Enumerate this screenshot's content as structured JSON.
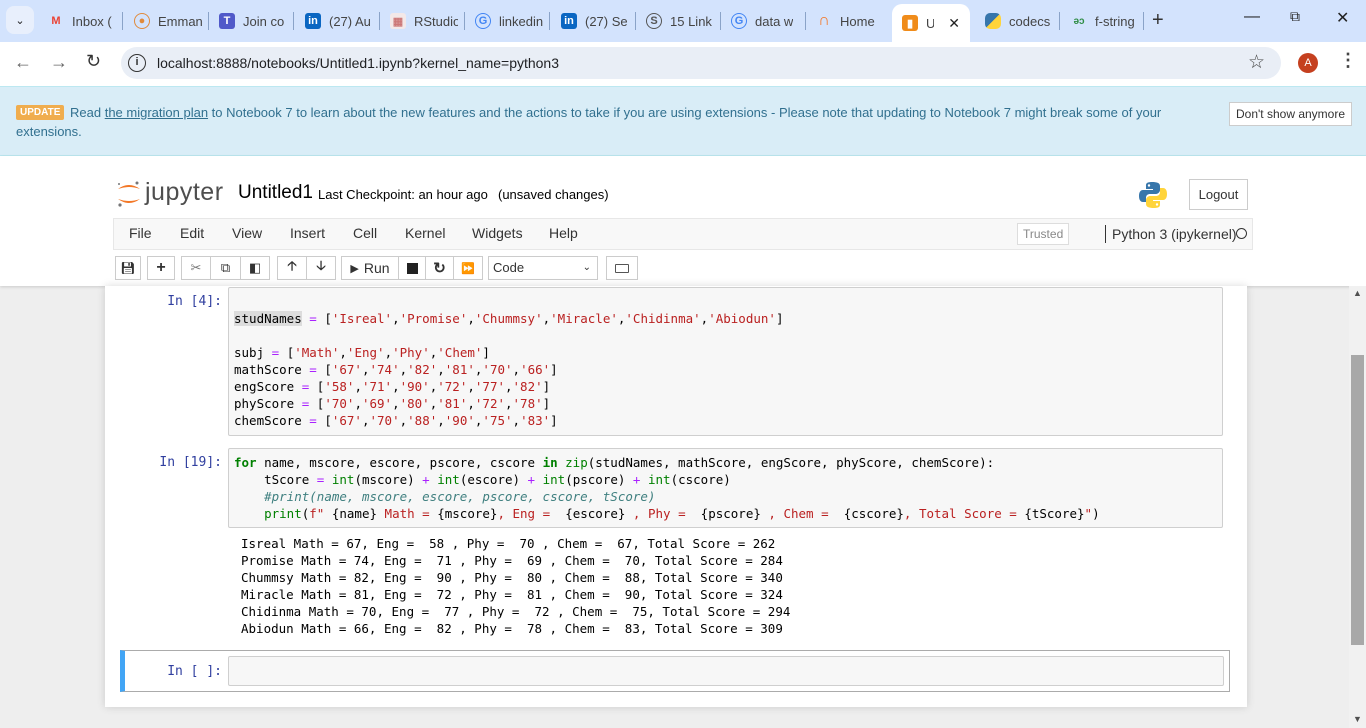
{
  "browser": {
    "tabs": [
      {
        "title": "Inbox (",
        "icon": "gmail-icon"
      },
      {
        "title": "Emman",
        "icon": "profile-site-icon"
      },
      {
        "title": "Join co",
        "icon": "teams-icon"
      },
      {
        "title": "(27) Au",
        "icon": "linkedin-icon"
      },
      {
        "title": "RStudio",
        "icon": "rstudio-icon"
      },
      {
        "title": "linkedin",
        "icon": "google-icon"
      },
      {
        "title": "(27) Se",
        "icon": "linkedin-icon"
      },
      {
        "title": "15 Link",
        "icon": "site-icon"
      },
      {
        "title": "data w",
        "icon": "google-icon"
      },
      {
        "title": "Home",
        "icon": "jupyter-icon"
      },
      {
        "title": "Un",
        "icon": "notebook-icon",
        "active": true
      },
      {
        "title": "codecs",
        "icon": "python-icon"
      },
      {
        "title": "f-string",
        "icon": "geeksforgeeks-icon"
      }
    ],
    "url": "localhost:8888/notebooks/Untitled1.ipynb?kernel_name=python3",
    "avatar_letter": "A"
  },
  "banner": {
    "badge": "UPDATE",
    "text_before": "Read ",
    "link": "the migration plan",
    "text_after": " to Notebook 7 to learn about the new features and the actions to take if you are using extensions - Please note that updating to Notebook 7 might break some of your extensions.",
    "dismiss_label": "Don't show anymore"
  },
  "jupyter": {
    "logo_text": "jupyter",
    "notebook_title": "Untitled1",
    "checkpoint": "Last Checkpoint: an hour ago",
    "unsaved": "(unsaved changes)",
    "logout_label": "Logout",
    "menu": [
      "File",
      "Edit",
      "View",
      "Insert",
      "Cell",
      "Kernel",
      "Widgets",
      "Help"
    ],
    "trusted_label": "Trusted",
    "kernel_name": "Python 3 (ipykernel)",
    "toolbar": {
      "run_label": "Run",
      "cell_type": "Code"
    }
  },
  "cells": [
    {
      "prompt": "In [4]:",
      "lines": [
        "",
        "studNames = ['Isreal','Promise','Chummsy','Miracle','Chidinma','Abiodun']",
        "",
        "subj = ['Math','Eng','Phy','Chem']",
        "mathScore = ['67','74','82','81','70','66']",
        "engScore = ['58','71','90','72','77','82']",
        "phyScore = ['70','69','80','81','72','78']",
        "chemScore = ['67','70','88','90','75','83']"
      ]
    },
    {
      "prompt": "In [19]:",
      "lines": [
        "for name, mscore, escore, pscore, cscore in zip(studNames, mathScore, engScore, phyScore, chemScore):",
        "    tScore = int(mscore) + int(escore) + int(pscore) + int(cscore)",
        "    #print(name, mscore, escore, pscore, cscore, tScore)",
        "    print(f\" {name} Math = {mscore}, Eng =  {escore} , Phy =  {pscore} , Chem =  {cscore}, Total Score = {tScore}\")"
      ],
      "output": [
        "Isreal Math = 67, Eng =  58 , Phy =  70 , Chem =  67, Total Score = 262",
        "Promise Math = 74, Eng =  71 , Phy =  69 , Chem =  70, Total Score = 284",
        "Chummsy Math = 82, Eng =  90 , Phy =  80 , Chem =  88, Total Score = 340",
        "Miracle Math = 81, Eng =  72 , Phy =  81 , Chem =  90, Total Score = 324",
        "Chidinma Math = 70, Eng =  77 , Phy =  72 , Chem =  75, Total Score = 294",
        "Abiodun Math = 66, Eng =  82 , Phy =  78 , Chem =  83, Total Score = 309"
      ]
    },
    {
      "prompt": "In [ ]:",
      "lines": [
        ""
      ]
    }
  ]
}
